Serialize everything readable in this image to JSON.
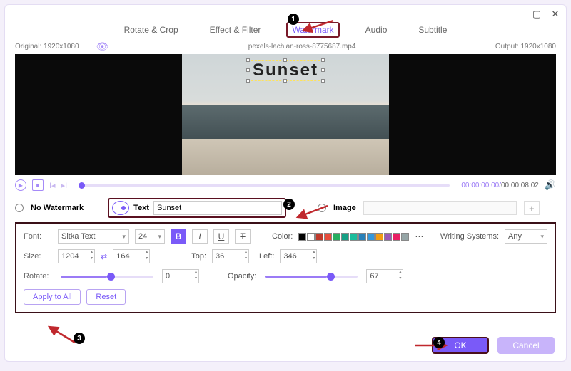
{
  "tabs": {
    "rotate": "Rotate & Crop",
    "effect": "Effect & Filter",
    "watermark": "Watermark",
    "audio": "Audio",
    "subtitle": "Subtitle"
  },
  "info": {
    "original": "Original: 1920x1080",
    "filename": "pexels-lachlan-ross-8775687.mp4",
    "output": "Output: 1920x1080"
  },
  "watermark_text": "Sunset",
  "time": {
    "current": "00:00:00.00",
    "duration": "00:00:08.02"
  },
  "mode": {
    "no_wm": "No Watermark",
    "text": "Text",
    "text_value": "Sunset",
    "image": "Image"
  },
  "props": {
    "font_label": "Font:",
    "font_family": "Sitka Text",
    "font_size": "24",
    "color_label": "Color:",
    "writing_label": "Writing Systems:",
    "writing_value": "Any",
    "size_label": "Size:",
    "size_w": "1204",
    "size_h": "164",
    "top_label": "Top:",
    "top": "36",
    "left_label": "Left:",
    "left": "346",
    "rotate_label": "Rotate:",
    "rotate": "0",
    "opacity_label": "Opacity:",
    "opacity": "67",
    "apply": "Apply to All",
    "reset": "Reset"
  },
  "swatches": [
    "#000000",
    "#ffffff",
    "#c0392b",
    "#e74c3c",
    "#27ae60",
    "#16a085",
    "#1abc9c",
    "#2980b9",
    "#3498db",
    "#f39c12",
    "#9b59b6",
    "#e91e63",
    "#95a5a6"
  ],
  "footer": {
    "ok": "OK",
    "cancel": "Cancel"
  }
}
